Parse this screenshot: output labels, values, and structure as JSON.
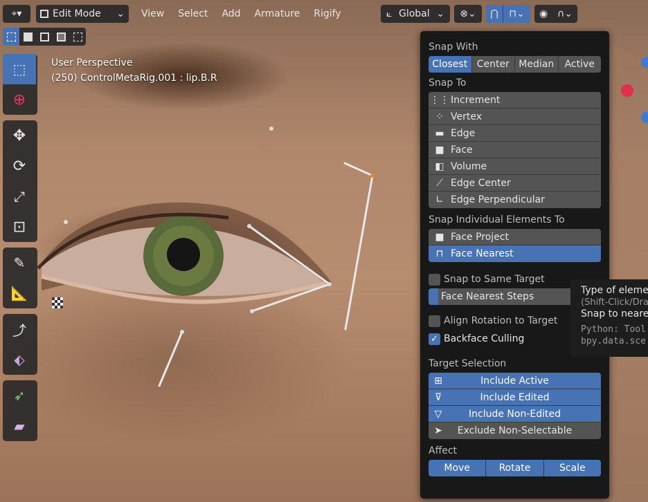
{
  "header": {
    "mode_label": "Edit Mode",
    "menus": [
      "View",
      "Select",
      "Add",
      "Armature",
      "Rigify"
    ],
    "transform_orientation": "Global"
  },
  "viewport": {
    "perspective_label": "User Perspective",
    "object_label": "(250) ControlMetaRig.001 : lip.B.R"
  },
  "snap_panel": {
    "snap_with_title": "Snap With",
    "snap_with_options": [
      "Closest",
      "Center",
      "Median",
      "Active"
    ],
    "snap_with_selected": "Closest",
    "snap_to_title": "Snap To",
    "snap_to_items": [
      "Increment",
      "Vertex",
      "Edge",
      "Face",
      "Volume",
      "Edge Center",
      "Edge Perpendicular"
    ],
    "individual_title": "Snap Individual Elements To",
    "individual_items": [
      "Face Project",
      "Face Nearest"
    ],
    "individual_selected": "Face Nearest",
    "same_target_label": "Snap to Same Target",
    "same_target_checked": false,
    "nearest_steps_label": "Face Nearest Steps",
    "align_rotation_label": "Align Rotation to Target",
    "align_rotation_checked": false,
    "backface_label": "Backface Culling",
    "backface_checked": true,
    "target_selection_title": "Target Selection",
    "target_items": [
      "Include Active",
      "Include Edited",
      "Include Non-Edited",
      "Exclude Non-Selectable"
    ],
    "affect_title": "Affect",
    "affect_options": [
      "Move",
      "Rotate",
      "Scale"
    ]
  },
  "tooltip": {
    "line1": "Type of elemen",
    "line2": "(Shift-Click/Dra",
    "line3": "Snap to neares",
    "python1": "Python: Tool",
    "python2": "bpy.data.sce"
  },
  "colors": {
    "accent": "#4772b3",
    "panel_bg": "#181818",
    "row_bg": "#545454"
  }
}
